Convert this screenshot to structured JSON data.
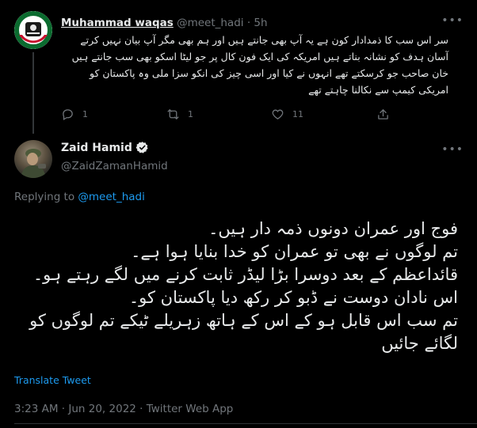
{
  "reply_tweet": {
    "author_name": "Muhammad waqas",
    "author_handle": "@meet_hadi",
    "separator": "·",
    "time_ago": "5h",
    "text": "سر اس سب کا ذمدادار کون ہے یہ آپ بھی جانتے ہیں اور ہم بھی مگر آپ بیان نہیں کرتے آسان ہدف کو نشانہ بناتے ہیں امریکہ کی ایک فون کال پر جو لیٹا اسکو بھی سب جانتے ہیں خان صاحب جو کرسکتے تھے انہوں نے کیا اور اسی چیز کی انکو سزا ملی وہ پاکستان کو امریکی کیمپ سے نکالنا چاہتے تھے",
    "reply_count": "1",
    "retweet_count": "1",
    "like_count": "11",
    "more_icon": "more-dots-icon"
  },
  "main_tweet": {
    "author_name": "Zaid Hamid",
    "author_handle": "@ZaidZamanHamid",
    "verified_icon": "verified-badge-icon",
    "replying_prefix": "Replying to",
    "replying_to": "@meet_hadi",
    "text_lines": [
      "فوج اور عمران دونوں ذمہ دار ہیں۔",
      "تم لوگوں نے بھی تو عمران کو خدا بنایا ہوا ہے۔",
      "قائداعظم کے بعد دوسرا بڑا لیڈر ثابت کرنے میں لگے رہتے ہو۔",
      "اس نادان دوست نے ڈبو کر رکھ دیا پاکستان کو۔",
      "تم سب اس قابل ہو کے اس کے ہاتھ زہریلے ٹیکے تم لوگوں کو لگائے جائیں"
    ],
    "translate_label": "Translate Tweet",
    "timestamp": "3:23 AM · Jun 20, 2022 · Twitter Web App"
  },
  "colors": {
    "background": "#000000",
    "text_primary": "#e7e9ea",
    "text_secondary": "#71767b",
    "accent": "#1d9bf0",
    "divider": "#2f3336"
  }
}
